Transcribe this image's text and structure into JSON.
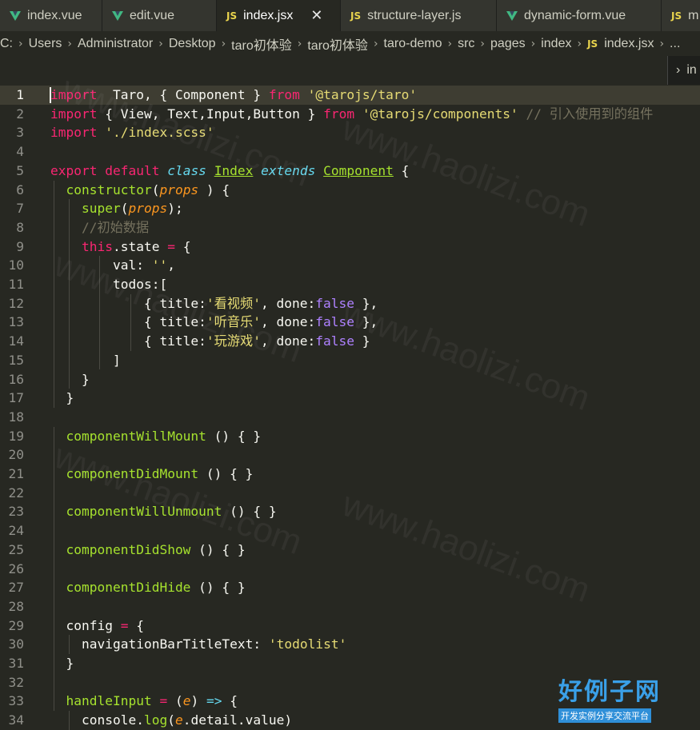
{
  "tabs": [
    {
      "label": "index.vue",
      "icon": "vue-icon",
      "active": false
    },
    {
      "label": "edit.vue",
      "icon": "vue-icon",
      "active": false
    },
    {
      "label": "index.jsx",
      "icon": "js-icon",
      "active": true
    },
    {
      "label": "structure-layer.js",
      "icon": "js-icon",
      "active": false
    },
    {
      "label": "dynamic-form.vue",
      "icon": "vue-icon",
      "active": false
    },
    {
      "label": "m",
      "icon": "js-icon",
      "active": false
    }
  ],
  "icons": {
    "js_badge": "JS",
    "close": "✕",
    "chevron": "›"
  },
  "breadcrumb": {
    "items": [
      "C:",
      "Users",
      "Administrator",
      "Desktop",
      "taro初体验",
      "taro初体验",
      "taro-demo",
      "src",
      "pages",
      "index"
    ],
    "file": "index.jsx",
    "ellipsis": "..."
  },
  "hover_widget": {
    "text": "in"
  },
  "editor": {
    "current_line": 1,
    "lines": [
      {
        "n": "1",
        "tokens": [
          [
            "kw",
            "import"
          ],
          [
            "",
            "  Taro, { Component } "
          ],
          [
            "kw",
            "from"
          ],
          [
            "",
            " "
          ],
          [
            "str",
            "'@tarojs/taro'"
          ]
        ]
      },
      {
        "n": "2",
        "tokens": [
          [
            "kw",
            "import"
          ],
          [
            "",
            " { View, Text,Input,Button } "
          ],
          [
            "kw",
            "from"
          ],
          [
            "",
            " "
          ],
          [
            "str",
            "'@tarojs/components'"
          ],
          [
            "",
            " "
          ],
          [
            "cmt",
            "// 引入使用到的组件"
          ]
        ]
      },
      {
        "n": "3",
        "tokens": [
          [
            "kw",
            "import"
          ],
          [
            "",
            " "
          ],
          [
            "str",
            "'./index.scss'"
          ]
        ]
      },
      {
        "n": "4",
        "tokens": []
      },
      {
        "n": "5",
        "tokens": [
          [
            "kw",
            "export default"
          ],
          [
            "",
            " "
          ],
          [
            "typ",
            "class"
          ],
          [
            "",
            " "
          ],
          [
            "cls",
            "Index"
          ],
          [
            "",
            " "
          ],
          [
            "typ",
            "extends"
          ],
          [
            "",
            " "
          ],
          [
            "cls",
            "Component"
          ],
          [
            "",
            " {"
          ]
        ]
      },
      {
        "n": "6",
        "tokens": [
          [
            "",
            "  "
          ],
          [
            "fn",
            "constructor"
          ],
          [
            "",
            "("
          ],
          [
            "prm",
            "props"
          ],
          [
            "",
            " ) {"
          ]
        ]
      },
      {
        "n": "7",
        "tokens": [
          [
            "",
            "    "
          ],
          [
            "fn",
            "super"
          ],
          [
            "",
            "("
          ],
          [
            "prm",
            "props"
          ],
          [
            "",
            ");"
          ]
        ]
      },
      {
        "n": "8",
        "tokens": [
          [
            "",
            "    "
          ],
          [
            "cmt",
            "//初始数据"
          ]
        ]
      },
      {
        "n": "9",
        "tokens": [
          [
            "",
            "    "
          ],
          [
            "kw",
            "this"
          ],
          [
            "",
            ".state "
          ],
          [
            "kw",
            "="
          ],
          [
            "",
            " {"
          ]
        ]
      },
      {
        "n": "10",
        "tokens": [
          [
            "",
            "        val: "
          ],
          [
            "str",
            "''"
          ],
          [
            "",
            ","
          ]
        ]
      },
      {
        "n": "11",
        "tokens": [
          [
            "",
            "        todos:["
          ]
        ]
      },
      {
        "n": "12",
        "tokens": [
          [
            "",
            "            { title:"
          ],
          [
            "str",
            "'看视频'"
          ],
          [
            "",
            ", done:"
          ],
          [
            "bool",
            "false"
          ],
          [
            "",
            " },"
          ]
        ]
      },
      {
        "n": "13",
        "tokens": [
          [
            "",
            "            { title:"
          ],
          [
            "str",
            "'听音乐'"
          ],
          [
            "",
            ", done:"
          ],
          [
            "bool",
            "false"
          ],
          [
            "",
            " },"
          ]
        ]
      },
      {
        "n": "14",
        "tokens": [
          [
            "",
            "            { title:"
          ],
          [
            "str",
            "'玩游戏'"
          ],
          [
            "",
            ", done:"
          ],
          [
            "bool",
            "false"
          ],
          [
            "",
            " }"
          ]
        ]
      },
      {
        "n": "15",
        "tokens": [
          [
            "",
            "        ]"
          ]
        ]
      },
      {
        "n": "16",
        "tokens": [
          [
            "",
            "    }"
          ]
        ]
      },
      {
        "n": "17",
        "tokens": [
          [
            "",
            "  }"
          ]
        ]
      },
      {
        "n": "18",
        "tokens": []
      },
      {
        "n": "19",
        "tokens": [
          [
            "",
            "  "
          ],
          [
            "fn",
            "componentWillMount"
          ],
          [
            "",
            " () { }"
          ]
        ]
      },
      {
        "n": "20",
        "tokens": []
      },
      {
        "n": "21",
        "tokens": [
          [
            "",
            "  "
          ],
          [
            "fn",
            "componentDidMount"
          ],
          [
            "",
            " () { }"
          ]
        ]
      },
      {
        "n": "22",
        "tokens": []
      },
      {
        "n": "23",
        "tokens": [
          [
            "",
            "  "
          ],
          [
            "fn",
            "componentWillUnmount"
          ],
          [
            "",
            " () { }"
          ]
        ]
      },
      {
        "n": "24",
        "tokens": []
      },
      {
        "n": "25",
        "tokens": [
          [
            "",
            "  "
          ],
          [
            "fn",
            "componentDidShow"
          ],
          [
            "",
            " () { }"
          ]
        ]
      },
      {
        "n": "26",
        "tokens": []
      },
      {
        "n": "27",
        "tokens": [
          [
            "",
            "  "
          ],
          [
            "fn",
            "componentDidHide"
          ],
          [
            "",
            " () { }"
          ]
        ]
      },
      {
        "n": "28",
        "tokens": []
      },
      {
        "n": "29",
        "tokens": [
          [
            "",
            "  config "
          ],
          [
            "kw",
            "="
          ],
          [
            "",
            " {"
          ]
        ]
      },
      {
        "n": "30",
        "tokens": [
          [
            "",
            "    navigationBarTitleText: "
          ],
          [
            "str",
            "'todolist'"
          ]
        ]
      },
      {
        "n": "31",
        "tokens": [
          [
            "",
            "  }"
          ]
        ]
      },
      {
        "n": "32",
        "tokens": []
      },
      {
        "n": "33",
        "tokens": [
          [
            "",
            "  "
          ],
          [
            "fn",
            "handleInput"
          ],
          [
            "",
            " "
          ],
          [
            "kw",
            "="
          ],
          [
            "",
            " ("
          ],
          [
            "prm",
            "e"
          ],
          [
            "",
            ") "
          ],
          [
            "typ",
            "=>"
          ],
          [
            "",
            " {"
          ]
        ]
      },
      {
        "n": "34",
        "tokens": [
          [
            "",
            "    console."
          ],
          [
            "fn",
            "log"
          ],
          [
            "",
            "("
          ],
          [
            "prm",
            "e"
          ],
          [
            "",
            ".detail.value)"
          ]
        ]
      }
    ]
  },
  "watermark": {
    "text": "www.haolizi.com"
  },
  "logo": {
    "title": "好例子网",
    "subtitle": "开发实例分享交流平台"
  }
}
